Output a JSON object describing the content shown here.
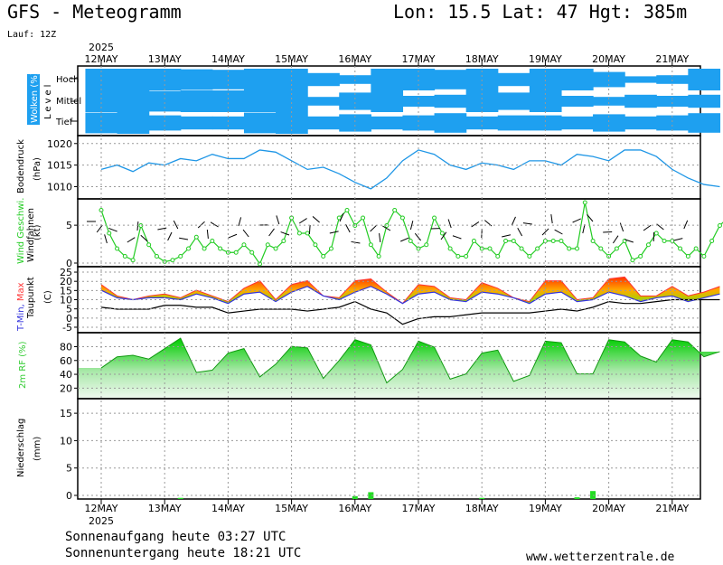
{
  "header": {
    "title": "GFS - Meteogramm",
    "lon": "Lon: 15.5",
    "lat": "Lat: 47",
    "hgt": "Hgt: 385m",
    "lauf": "Lauf: 12Z"
  },
  "footer": {
    "sunrise": "Sonnenaufgang heute 03:27 UTC",
    "sunset": "Sonnenuntergang heute 18:21 UTC",
    "site": "www.wetterzentrale.de"
  },
  "year": "2025",
  "dates": [
    "12MAY",
    "13MAY",
    "14MAY",
    "15MAY",
    "16MAY",
    "17MAY",
    "18MAY",
    "19MAY",
    "20MAY",
    "21MAY"
  ],
  "colors": {
    "cloud": "#1ea0f0",
    "pressure": "#1e96e6",
    "wind": "#22cc22",
    "dew": "#000000",
    "tmin": "#3333dd",
    "tmax": "#ff3333",
    "rh": "#33cc33",
    "precip": "#22dd22",
    "grid": "#999999"
  },
  "chart_data": [
    {
      "type": "heatmap",
      "title": "Wolken (%)",
      "ylabel": "Level",
      "levels": [
        "Hoch",
        "Mittel",
        "Tief"
      ],
      "x": [
        "12MAY 06Z",
        "12MAY 18Z",
        "13MAY 06Z",
        "13MAY 18Z",
        "14MAY 06Z",
        "14MAY 18Z",
        "15MAY 06Z",
        "15MAY 18Z",
        "16MAY 06Z",
        "16MAY 18Z",
        "17MAY 06Z",
        "17MAY 18Z",
        "18MAY 06Z",
        "18MAY 18Z",
        "19MAY 06Z",
        "19MAY 18Z",
        "20MAY 06Z",
        "20MAY 18Z",
        "21MAY 06Z",
        "21MAY 18Z"
      ],
      "series": [
        {
          "name": "Hoch",
          "values": [
            100,
            100,
            100,
            95,
            90,
            100,
            100,
            60,
            40,
            100,
            100,
            90,
            100,
            60,
            100,
            100,
            70,
            30,
            40,
            100
          ]
        },
        {
          "name": "Mittel",
          "values": [
            100,
            100,
            95,
            100,
            100,
            100,
            100,
            40,
            80,
            100,
            50,
            60,
            100,
            80,
            100,
            50,
            40,
            60,
            50,
            60
          ]
        },
        {
          "name": "Tief",
          "values": [
            95,
            100,
            70,
            60,
            60,
            95,
            100,
            60,
            80,
            60,
            70,
            90,
            60,
            70,
            70,
            60,
            80,
            60,
            70,
            90
          ]
        }
      ]
    },
    {
      "type": "line",
      "title": "Bodendruck",
      "ylabel": "(hPa)",
      "ylim": [
        1008,
        1021
      ],
      "ticks": [
        1010,
        1015,
        1020
      ],
      "x": [
        0,
        6,
        12,
        18,
        24,
        30,
        36,
        42,
        48,
        54,
        60,
        66,
        72,
        78,
        84,
        90,
        96,
        102,
        108,
        114,
        120,
        126,
        132,
        138,
        144,
        150,
        156,
        162,
        168,
        174,
        180,
        186,
        192,
        198,
        204,
        210,
        216,
        222,
        228,
        234
      ],
      "values": [
        1014,
        1015,
        1013.5,
        1015.5,
        1015,
        1016.5,
        1016,
        1017.5,
        1016.5,
        1016.5,
        1018.5,
        1018,
        1016,
        1014,
        1014.5,
        1013,
        1011,
        1009.5,
        1012,
        1016,
        1018.5,
        1017.5,
        1015,
        1014,
        1015.5,
        1015,
        1014,
        1016,
        1016,
        1015,
        1017.5,
        1017,
        1016,
        1018.5,
        1018.5,
        1017,
        1014,
        1012,
        1010.5,
        1010
      ]
    },
    {
      "type": "line",
      "title": "Wind Geschwi.",
      "ylabel": "(kt)",
      "legend": "Windfahnen",
      "ylim": [
        0,
        8
      ],
      "ticks": [
        0,
        5
      ],
      "x": [
        0,
        3,
        6,
        9,
        12,
        15,
        18,
        21,
        24,
        27,
        30,
        33,
        36,
        39,
        42,
        45,
        48,
        51,
        54,
        57,
        60,
        63,
        66,
        69,
        72,
        75,
        78,
        81,
        84,
        87,
        90,
        93,
        96,
        99,
        102,
        105,
        108,
        111,
        114,
        117,
        120,
        123,
        126,
        129,
        132,
        135,
        138,
        141,
        144,
        147,
        150,
        153,
        156,
        159,
        162,
        165,
        168,
        171,
        174,
        177,
        180,
        183,
        186,
        189,
        192,
        195,
        198,
        201,
        204,
        207,
        210,
        213,
        216,
        219,
        222,
        225,
        228,
        231,
        234,
        237
      ],
      "values": [
        7,
        4,
        2,
        1,
        0.5,
        5,
        2.5,
        1,
        0.3,
        0.5,
        1,
        2,
        3.5,
        2,
        3,
        2,
        1.5,
        1.5,
        2.5,
        1.5,
        0,
        2.5,
        2,
        3,
        6,
        4,
        4,
        2.5,
        1,
        2,
        6,
        7,
        5,
        6,
        2.5,
        1,
        5,
        7,
        6,
        3,
        2,
        2.5,
        6,
        4,
        2,
        1,
        1,
        3,
        2,
        2,
        1,
        3,
        3,
        2,
        1,
        2,
        3,
        3,
        3,
        2,
        2,
        8,
        3,
        2,
        1,
        2,
        3,
        0.5,
        1,
        2.5,
        4,
        3,
        3,
        2,
        1,
        2,
        1,
        3,
        5,
        6
      ]
    },
    {
      "type": "area",
      "title": "T-Min, Max",
      "legend": [
        "T-Min",
        "Max",
        "Taupunkt"
      ],
      "ylabel": "(C)",
      "ylim": [
        -6,
        26
      ],
      "ticks": [
        -5,
        0,
        5,
        10,
        15,
        20,
        25
      ],
      "x": [
        0,
        6,
        12,
        18,
        24,
        30,
        36,
        42,
        48,
        54,
        60,
        66,
        72,
        78,
        84,
        90,
        96,
        102,
        108,
        114,
        120,
        126,
        132,
        138,
        144,
        150,
        156,
        162,
        168,
        174,
        180,
        186,
        192,
        198,
        204,
        210,
        216,
        222,
        228,
        234
      ],
      "series": [
        {
          "name": "T-Min",
          "values": [
            15,
            11,
            10,
            11,
            11,
            10,
            13,
            11,
            8,
            13,
            14,
            9,
            14,
            17,
            12,
            10,
            14,
            17,
            13,
            8,
            13,
            14,
            10,
            9,
            14,
            13,
            11,
            8,
            13,
            14,
            9,
            10,
            14,
            12,
            9,
            11,
            12,
            9,
            11,
            13
          ]
        },
        {
          "name": "Max",
          "values": [
            18,
            12,
            10,
            12,
            13,
            11,
            15,
            12,
            9,
            16,
            20,
            10,
            18,
            20,
            12,
            11,
            20,
            21,
            14,
            8,
            18,
            17,
            11,
            10,
            19,
            16,
            11,
            9,
            20,
            20,
            10,
            11,
            21,
            22,
            12,
            12,
            17,
            12,
            14,
            17
          ]
        },
        {
          "name": "Taupunkt",
          "values": [
            6,
            5,
            5,
            5,
            7,
            7,
            6,
            6,
            3,
            4,
            5,
            5,
            5,
            4,
            5,
            6,
            9,
            5,
            3,
            -3,
            0,
            1,
            1,
            2,
            3,
            3,
            3,
            3,
            4,
            5,
            4,
            6,
            9,
            8,
            8,
            9,
            10,
            10,
            10,
            10
          ]
        }
      ]
    },
    {
      "type": "area",
      "title": "2m RF (%)",
      "ylim": [
        10,
        95
      ],
      "ticks": [
        20,
        40,
        60,
        80
      ],
      "x": [
        0,
        6,
        12,
        18,
        24,
        30,
        36,
        42,
        48,
        54,
        60,
        66,
        72,
        78,
        84,
        90,
        96,
        102,
        108,
        114,
        120,
        126,
        132,
        138,
        144,
        150,
        156,
        162,
        168,
        174,
        180,
        186,
        192,
        198,
        204,
        210,
        216,
        222,
        228,
        234
      ],
      "values": [
        50,
        65,
        67,
        62,
        76,
        90,
        44,
        47,
        70,
        76,
        38,
        55,
        79,
        77,
        36,
        60,
        88,
        81,
        30,
        48,
        86,
        78,
        35,
        42,
        70,
        74,
        32,
        40,
        86,
        84,
        42,
        42,
        88,
        85,
        66,
        58,
        88,
        85,
        65,
        72
      ]
    },
    {
      "type": "bar",
      "title": "Niederschlag",
      "ylabel": "(mm)",
      "ylim": [
        0,
        17
      ],
      "ticks": [
        0,
        5,
        10,
        15
      ],
      "x": [
        30,
        96,
        102,
        144,
        180,
        186
      ],
      "values": [
        0.2,
        0.5,
        1.2,
        0.2,
        0.3,
        1.4
      ]
    }
  ]
}
